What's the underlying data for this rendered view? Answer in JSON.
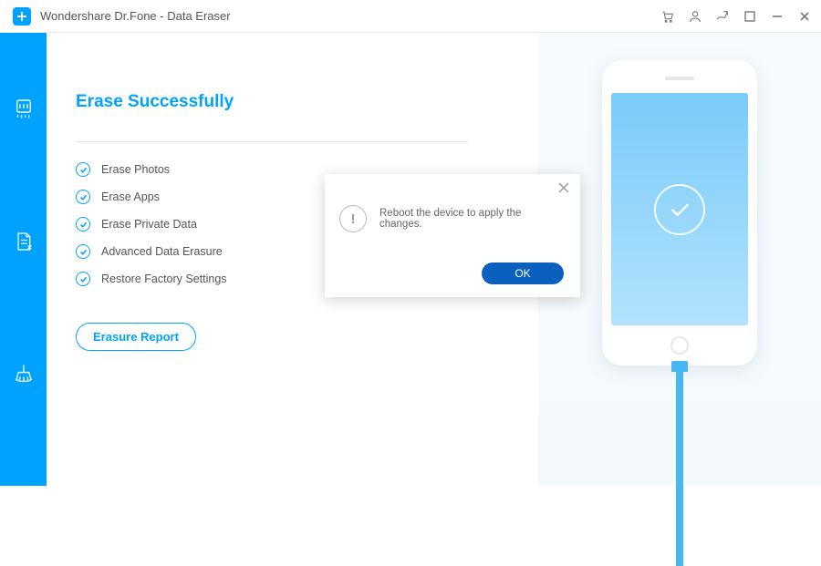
{
  "titlebar": {
    "app_title": "Wondershare Dr.Fone - Data Eraser"
  },
  "page_title": "Erase Successfully",
  "items": [
    {
      "label": "Erase Photos"
    },
    {
      "label": "Erase Apps"
    },
    {
      "label": "Erase Private Data"
    },
    {
      "label": "Advanced Data Erasure"
    },
    {
      "label": "Restore Factory Settings"
    }
  ],
  "report_button": "Erasure Report",
  "modal": {
    "message": "Reboot the device to apply the changes.",
    "ok": "OK"
  }
}
